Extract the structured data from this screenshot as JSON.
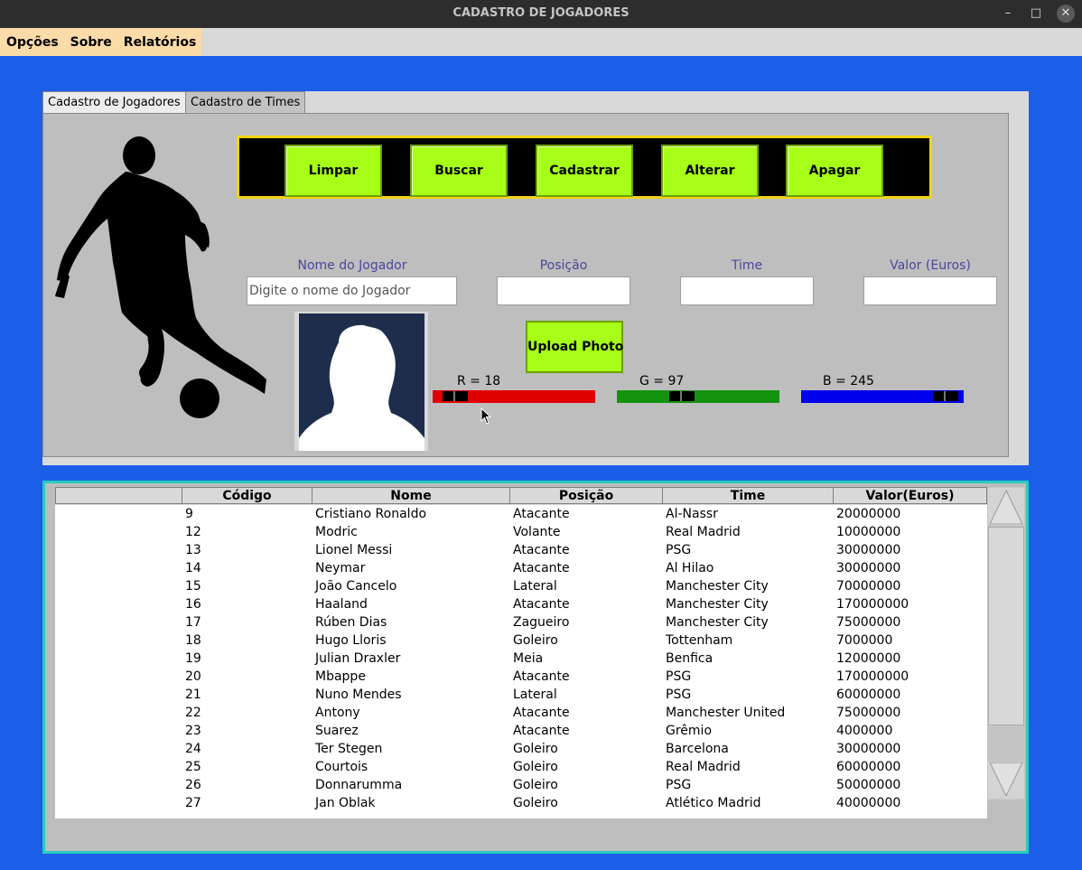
{
  "window": {
    "title": "CADASTRO DE JOGADORES",
    "minimize_glyph": "–",
    "maximize_glyph": "□",
    "close_glyph": "✕"
  },
  "menu": [
    "Opções",
    "Sobre",
    "Relatórios"
  ],
  "tabs": [
    "Cadastro de Jogadores",
    "Cadastro de Times"
  ],
  "buttons": [
    "Limpar",
    "Buscar",
    "Cadastrar",
    "Alterar",
    "Apagar"
  ],
  "fields": [
    {
      "label": "Nome do Jogador",
      "value": "Digite o nome do Jogador"
    },
    {
      "label": "Posição",
      "value": ""
    },
    {
      "label": "Time",
      "value": ""
    },
    {
      "label": "Valor (Euros)",
      "value": ""
    }
  ],
  "upload_label": "Upload Photo",
  "color_sliders": [
    {
      "label": "R = 18",
      "value": 18,
      "max": 255,
      "color": "#e00000"
    },
    {
      "label": "G = 97",
      "value": 97,
      "max": 255,
      "color": "#13930e"
    },
    {
      "label": "B = 245",
      "value": 245,
      "max": 255,
      "color": "#0000ee"
    }
  ],
  "table": {
    "columns": [
      "",
      "Código",
      "Nome",
      "Posição",
      "Time",
      "Valor(Euros)"
    ],
    "rows": [
      [
        "9",
        "Cristiano Ronaldo",
        "Atacante",
        "Al-Nassr",
        "20000000"
      ],
      [
        "12",
        "Modric",
        "Volante",
        "Real Madrid",
        "10000000"
      ],
      [
        "13",
        "Lionel Messi",
        "Atacante",
        "PSG",
        "30000000"
      ],
      [
        "14",
        "Neymar",
        "Atacante",
        "Al Hilao",
        "30000000"
      ],
      [
        "15",
        "João Cancelo",
        "Lateral",
        "Manchester City",
        "70000000"
      ],
      [
        "16",
        "Haaland",
        "Atacante",
        "Manchester City",
        "170000000"
      ],
      [
        "17",
        "Rúben Dias",
        "Zagueiro",
        "Manchester City",
        "75000000"
      ],
      [
        "18",
        "Hugo Lloris",
        "Goleiro",
        "Tottenham",
        "7000000"
      ],
      [
        "19",
        "Julian Draxler",
        "Meia",
        "Benfica",
        "12000000"
      ],
      [
        "20",
        "Mbappe",
        "Atacante",
        "PSG",
        "170000000"
      ],
      [
        "21",
        "Nuno Mendes",
        "Lateral",
        "PSG",
        "60000000"
      ],
      [
        "22",
        "Antony",
        "Atacante",
        "Manchester United",
        "75000000"
      ],
      [
        "23",
        "Suarez",
        "Atacante",
        "Grêmio",
        "4000000"
      ],
      [
        "24",
        "Ter Stegen",
        "Goleiro",
        "Barcelona",
        "30000000"
      ],
      [
        "25",
        "Courtois",
        "Goleiro",
        "Real Madrid",
        "60000000"
      ],
      [
        "26",
        "Donnarumma",
        "Goleiro",
        "PSG",
        "50000000"
      ],
      [
        "27",
        "Jan Oblak",
        "Goleiro",
        "Atlético Madrid",
        "40000000"
      ]
    ]
  },
  "colors": {
    "background": "#1b5ee8",
    "button": "#a7ff17",
    "button_frame": "#f3d413",
    "table_border": "#28ccbc"
  }
}
